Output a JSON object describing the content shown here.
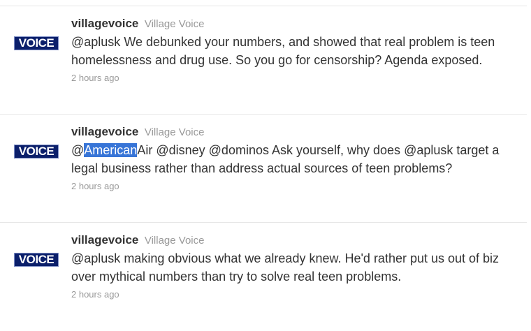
{
  "tweets": [
    {
      "avatar_text": "VOICE",
      "screen_name": "villagevoice",
      "full_name": "Village Voice",
      "mention1": "@aplusk",
      "text": " We debunked your numbers, and showed that real problem is teen homelessness and drug use. So you go for censorship? Agenda exposed.",
      "time": "2 hours ago"
    },
    {
      "avatar_text": "VOICE",
      "screen_name": "villagevoice",
      "full_name": "Village Voice",
      "at": "@",
      "selected": "American",
      "air": "Air",
      "mention2": "@disney",
      "mention3": "@dominos",
      "text_a": " Ask yourself, why does ",
      "mention4": "@aplusk",
      "text_b": " target a legal business rather than address actual sources of teen problems?",
      "time": "2 hours ago"
    },
    {
      "avatar_text": "VOICE",
      "screen_name": "villagevoice",
      "full_name": "Village Voice",
      "mention1": "@aplusk",
      "text": " making obvious what we already knew. He'd rather put us out of biz over mythical numbers than try to solve real teen problems.",
      "time": "2 hours ago"
    }
  ]
}
